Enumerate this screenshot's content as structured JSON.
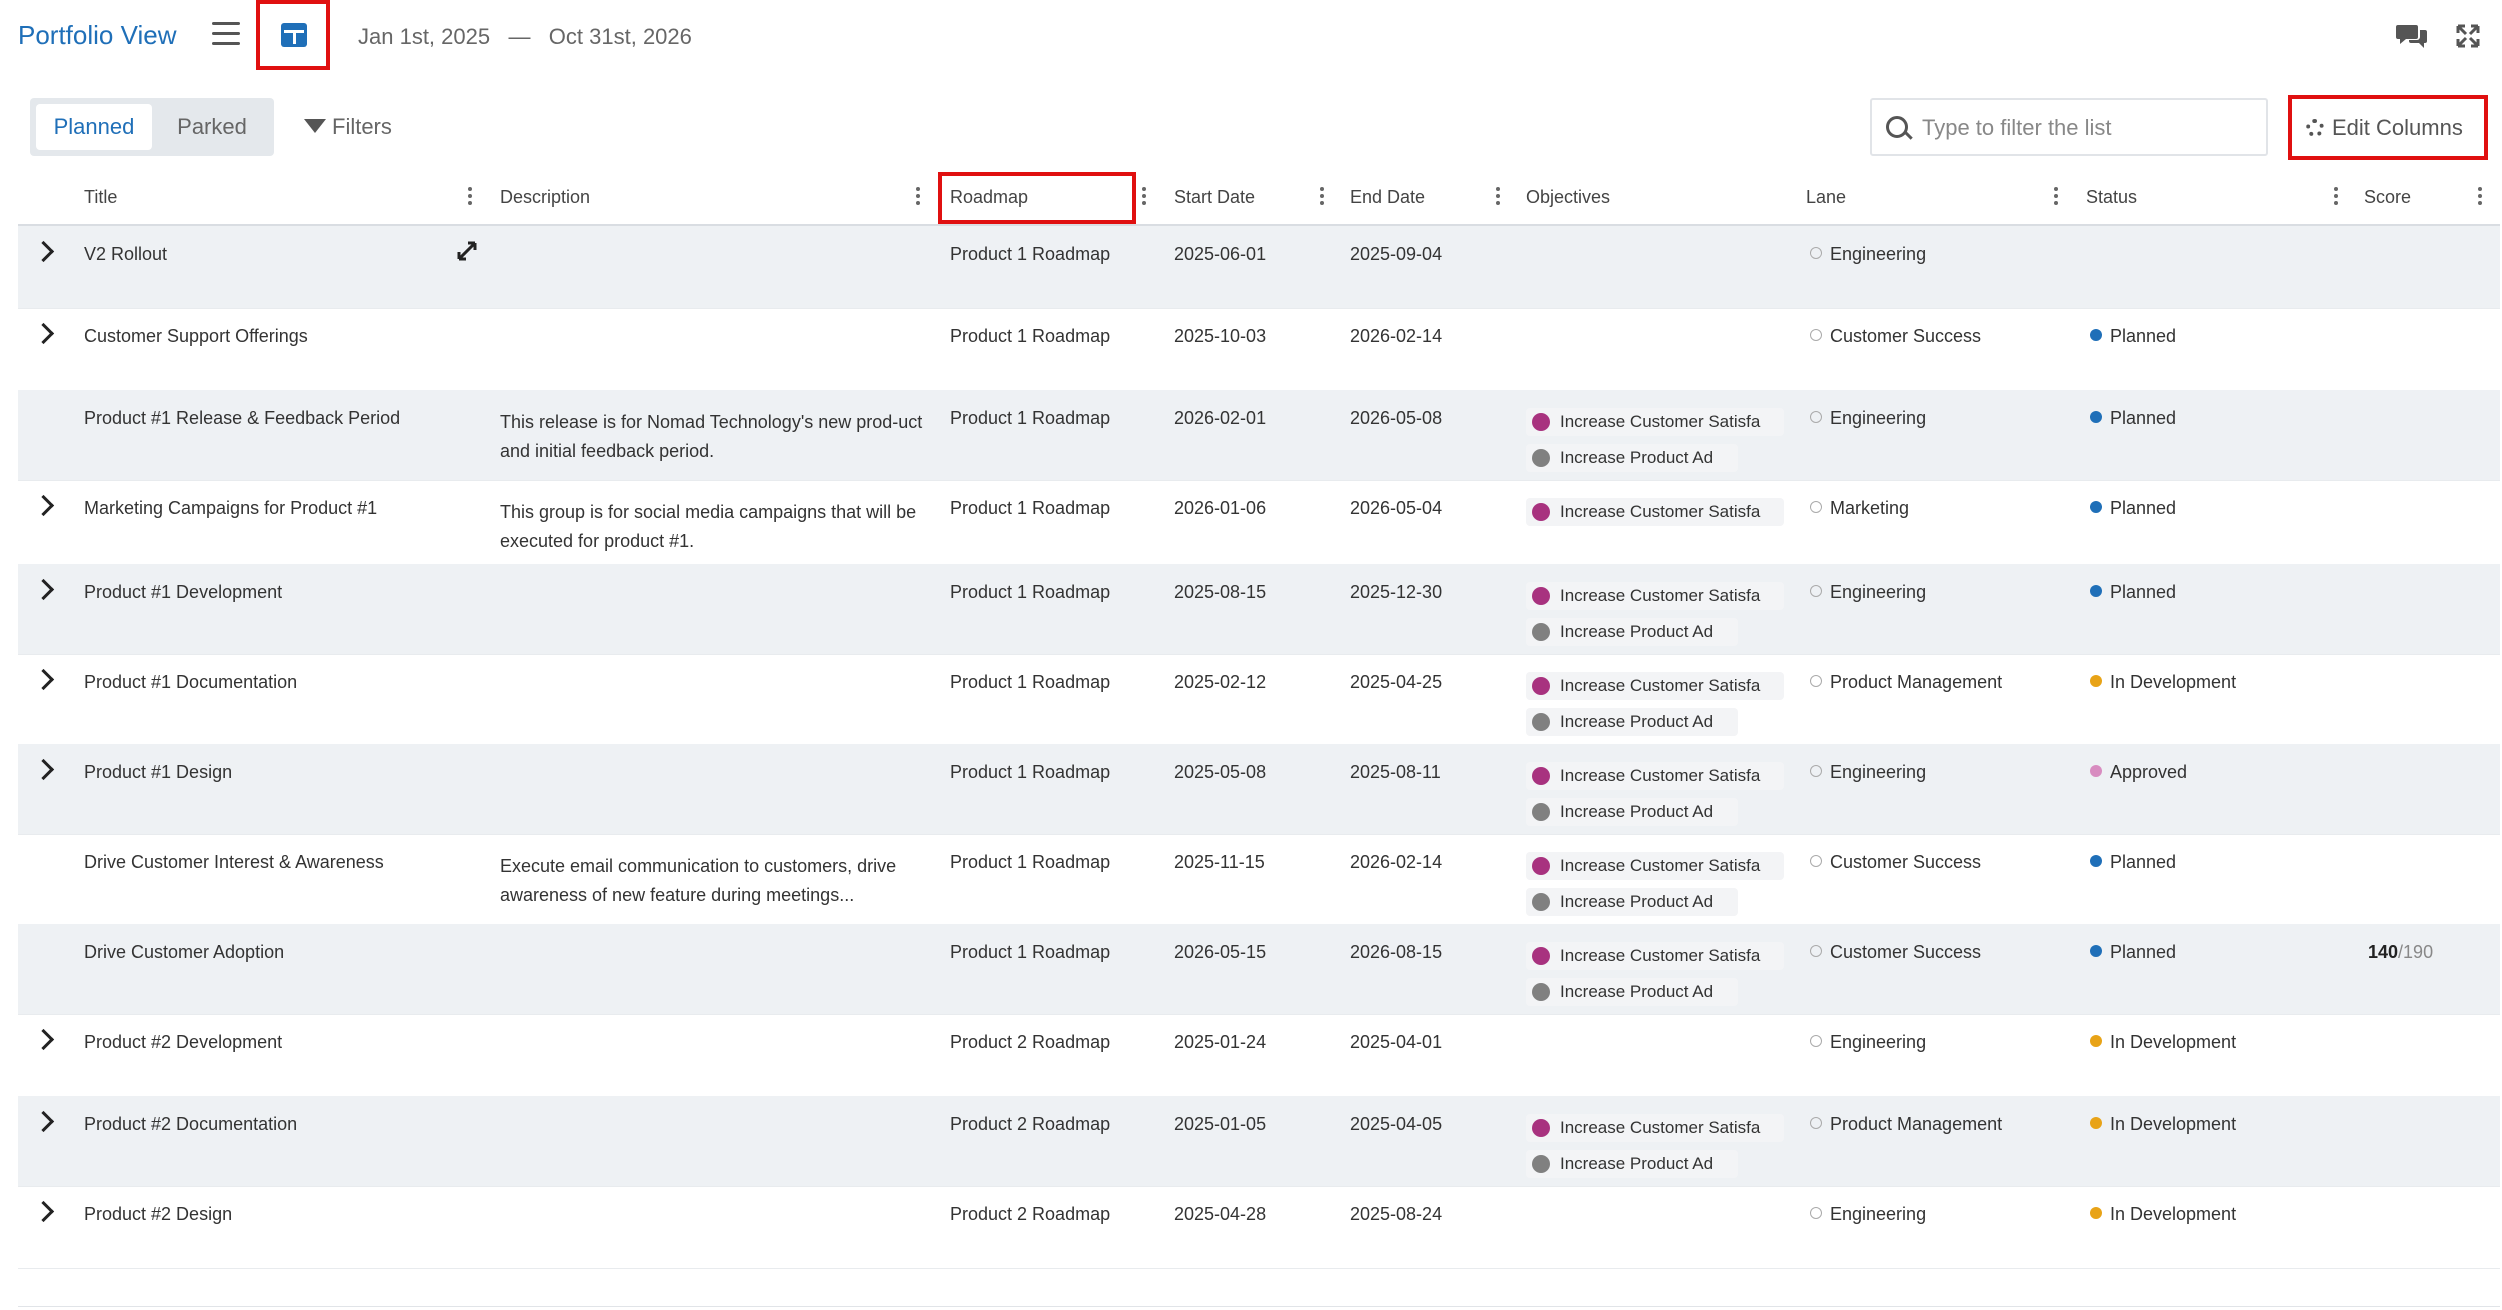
{
  "header": {
    "title": "Portfolio View",
    "date_start": "Jan 1st, 2025",
    "date_sep": "—",
    "date_end": "Oct 31st, 2026"
  },
  "toolbar": {
    "tab_planned": "Planned",
    "tab_parked": "Parked",
    "filters_label": "Filters",
    "search_placeholder": "Type to filter the list",
    "edit_columns_label": "Edit Columns"
  },
  "columns": {
    "title": "Title",
    "description": "Description",
    "roadmap": "Roadmap",
    "start_date": "Start Date",
    "end_date": "End Date",
    "objectives": "Objectives",
    "lane": "Lane",
    "status": "Status",
    "score": "Score"
  },
  "colors": {
    "accent": "#1f6fb8",
    "highlight": "#e01010",
    "objective_1": "#a8327f",
    "objective_2": "#808080",
    "status_planned": "#1f6fb8",
    "status_in_development": "#e8a317",
    "status_approved": "#d88cc0"
  },
  "rows": [
    {
      "title": "V2 Rollout",
      "expandable": true,
      "description": "",
      "roadmap": "Product 1 Roadmap",
      "start": "2025-06-01",
      "end": "2025-09-04",
      "objectives": [],
      "lane": "Engineering",
      "status": "",
      "score": ""
    },
    {
      "title": "Customer Support Offerings",
      "expandable": true,
      "description": "",
      "roadmap": "Product 1 Roadmap",
      "start": "2025-10-03",
      "end": "2026-02-14",
      "objectives": [],
      "lane": "Customer Success",
      "status": "Planned",
      "score": ""
    },
    {
      "title": "Product #1 Release & Feedback Period",
      "expandable": false,
      "description": "This release is for Nomad Technology's new prod-uct and initial feedback period.",
      "roadmap": "Product 1 Roadmap",
      "start": "2026-02-01",
      "end": "2026-05-08",
      "objectives": [
        "Increase Customer Satisfa",
        "Increase Product Ad"
      ],
      "lane": "Engineering",
      "status": "Planned",
      "score": ""
    },
    {
      "title": "Marketing Campaigns for Product #1",
      "expandable": true,
      "description": "This group is for social media campaigns that will be executed for product #1.",
      "roadmap": "Product 1 Roadmap",
      "start": "2026-01-06",
      "end": "2026-05-04",
      "objectives": [
        "Increase Customer Satisfa"
      ],
      "lane": "Marketing",
      "status": "Planned",
      "score": ""
    },
    {
      "title": "Product #1 Development",
      "expandable": true,
      "description": "",
      "roadmap": "Product 1 Roadmap",
      "start": "2025-08-15",
      "end": "2025-12-30",
      "objectives": [
        "Increase Customer Satisfa",
        "Increase Product Ad"
      ],
      "lane": "Engineering",
      "status": "Planned",
      "score": ""
    },
    {
      "title": "Product #1 Documentation",
      "expandable": true,
      "description": "",
      "roadmap": "Product 1 Roadmap",
      "start": "2025-02-12",
      "end": "2025-04-25",
      "objectives": [
        "Increase Customer Satisfa",
        "Increase Product Ad"
      ],
      "lane": "Product Management",
      "status": "In Development",
      "score": ""
    },
    {
      "title": "Product #1 Design",
      "expandable": true,
      "description": "",
      "roadmap": "Product 1 Roadmap",
      "start": "2025-05-08",
      "end": "2025-08-11",
      "objectives": [
        "Increase Customer Satisfa",
        "Increase Product Ad"
      ],
      "lane": "Engineering",
      "status": "Approved",
      "score": ""
    },
    {
      "title": "Drive Customer Interest & Awareness",
      "expandable": false,
      "description": "Execute email communication to customers, drive awareness of new feature during meetings...",
      "roadmap": "Product 1 Roadmap",
      "start": "2025-11-15",
      "end": "2026-02-14",
      "objectives": [
        "Increase Customer Satisfa",
        "Increase Product Ad"
      ],
      "lane": "Customer Success",
      "status": "Planned",
      "score": ""
    },
    {
      "title": "Drive Customer Adoption",
      "expandable": false,
      "description": "",
      "roadmap": "Product 1 Roadmap",
      "start": "2026-05-15",
      "end": "2026-08-15",
      "objectives": [
        "Increase Customer Satisfa",
        "Increase Product Ad"
      ],
      "lane": "Customer Success",
      "status": "Planned",
      "score": "140",
      "score_max": "/190"
    },
    {
      "title": "Product #2 Development",
      "expandable": true,
      "description": "",
      "roadmap": "Product 2 Roadmap",
      "start": "2025-01-24",
      "end": "2025-04-01",
      "objectives": [],
      "lane": "Engineering",
      "status": "In Development",
      "score": ""
    },
    {
      "title": "Product #2 Documentation",
      "expandable": true,
      "description": "",
      "roadmap": "Product 2 Roadmap",
      "start": "2025-01-05",
      "end": "2025-04-05",
      "objectives": [
        "Increase Customer Satisfa",
        "Increase Product Ad"
      ],
      "lane": "Product Management",
      "status": "In Development",
      "score": ""
    },
    {
      "title": "Product #2 Design",
      "expandable": true,
      "description": "",
      "roadmap": "Product 2 Roadmap",
      "start": "2025-04-28",
      "end": "2025-08-24",
      "objectives": [],
      "lane": "Engineering",
      "status": "In Development",
      "score": ""
    }
  ]
}
